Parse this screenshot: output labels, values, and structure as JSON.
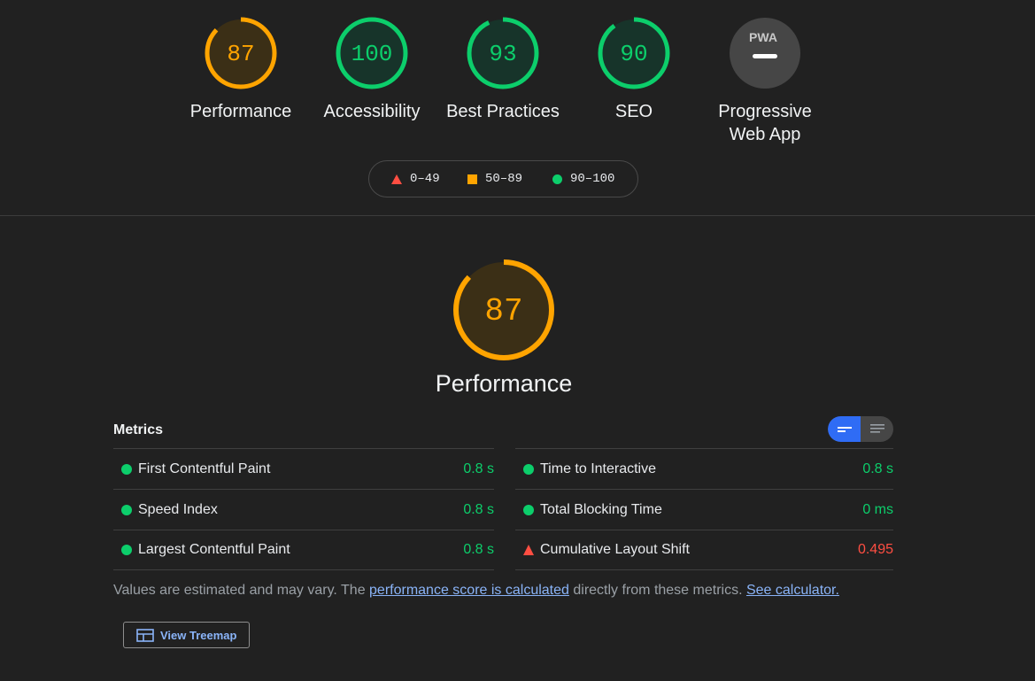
{
  "summary": {
    "gauges": [
      {
        "score": "87",
        "label": "Performance",
        "color": "#ffa400",
        "fraction": 0.87
      },
      {
        "score": "100",
        "label": "Accessibility",
        "color": "#0cce6b",
        "fraction": 1.0
      },
      {
        "score": "93",
        "label": "Best Practices",
        "color": "#0cce6b",
        "fraction": 0.93
      },
      {
        "score": "90",
        "label": "SEO",
        "color": "#0cce6b",
        "fraction": 0.9
      }
    ],
    "pwa": {
      "badge_text": "PWA",
      "label_line1": "Progressive",
      "label_line2": "Web App"
    }
  },
  "legend": {
    "fail": "0–49",
    "average": "50–89",
    "pass": "90–100"
  },
  "performance": {
    "score": "87",
    "fraction": 0.87,
    "title": "Performance",
    "color": "#ffa400"
  },
  "metrics": {
    "heading": "Metrics",
    "left": [
      {
        "label": "First Contentful Paint",
        "value": "0.8 s",
        "status": "pass"
      },
      {
        "label": "Speed Index",
        "value": "0.8 s",
        "status": "pass"
      },
      {
        "label": "Largest Contentful Paint",
        "value": "0.8 s",
        "status": "pass"
      }
    ],
    "right": [
      {
        "label": "Time to Interactive",
        "value": "0.8 s",
        "status": "pass"
      },
      {
        "label": "Total Blocking Time",
        "value": "0 ms",
        "status": "pass"
      },
      {
        "label": "Cumulative Layout Shift",
        "value": "0.495",
        "status": "fail"
      }
    ]
  },
  "note": {
    "prefix": "Values are estimated and may vary. The ",
    "link1": "performance score is calculated",
    "middle": " directly from these metrics. ",
    "link2": "See calculator."
  },
  "treemap": {
    "label": "View Treemap"
  },
  "colors": {
    "pass": "#0cce6b",
    "average": "#ffa400",
    "fail": "#ff4e42",
    "accent": "#2f6cf5",
    "link": "#8ab4f8"
  }
}
